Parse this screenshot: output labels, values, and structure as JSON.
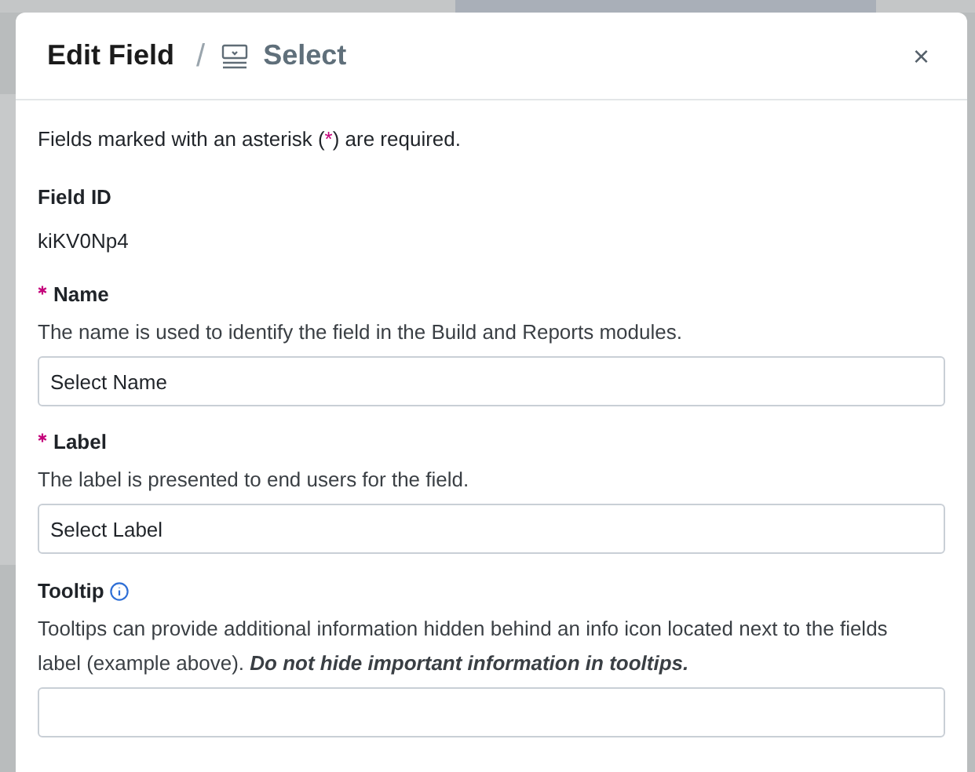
{
  "header": {
    "title": "Edit Field",
    "separator": "/",
    "field_type": "Select",
    "close": "×"
  },
  "intro": {
    "before": "Fields marked with an asterisk (",
    "mark": "*",
    "after": ") are required."
  },
  "field_id": {
    "label": "Field ID",
    "value": "kiKV0Np4"
  },
  "fields": [
    {
      "label": "Name",
      "required": true,
      "info": false,
      "description": "The name is used to identify the field in the Build and Reports modules.",
      "value": "Select Name"
    },
    {
      "label": "Label",
      "required": true,
      "info": false,
      "description": "The label is presented to end users for the field.",
      "value": "Select Label"
    },
    {
      "label": "Tooltip",
      "required": false,
      "info": true,
      "description": "Tooltips can provide additional information hidden behind an info icon located next to the fields label (example above).",
      "warning": "Do not hide important information in tooltips."
    }
  ]
}
